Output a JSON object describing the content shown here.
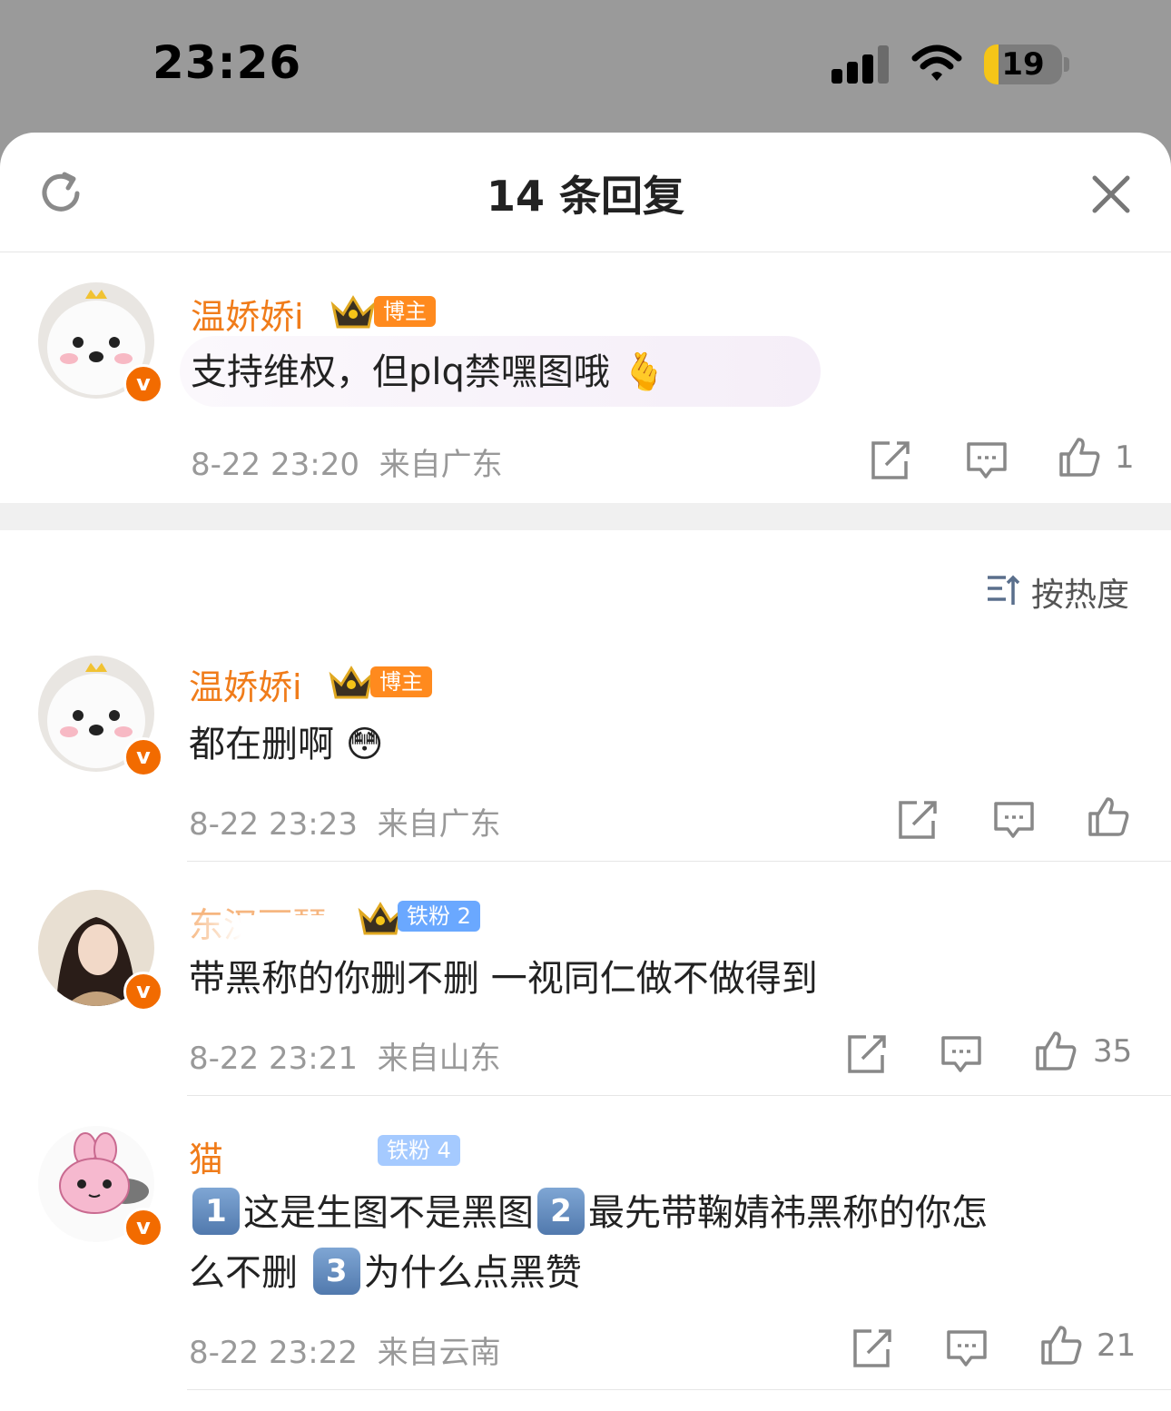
{
  "status_bar": {
    "time": "23:26",
    "battery": "19",
    "battery_level": 0.19
  },
  "header": {
    "title": "14 条回复"
  },
  "root_comment": {
    "username": "温娇娇i",
    "role_badge": "博主",
    "text": "支持维权，但plq禁嘿图哦",
    "emoji": "🫰",
    "date": "8-22 23:20",
    "location": "来自广东",
    "likes": "1"
  },
  "sort": {
    "label": "按热度"
  },
  "replies": [
    {
      "username": "温娇娇i",
      "role_badge": "博主",
      "text": "都在删啊",
      "emoji": "😳",
      "date": "8-22 23:23",
      "location": "来自广东",
      "likes": ""
    },
    {
      "username": "东汉丽琴",
      "fan_badge": "铁粉 2",
      "text": "带黑称的你删不删 一视同仁做不做得到",
      "date": "8-22 23:21",
      "location": "来自山东",
      "likes": "35"
    },
    {
      "username": "猫",
      "fan_badge": "铁粉 4",
      "parts": [
        "1",
        "这是生图不是黑图",
        "2",
        "最先带鞠婧祎黑称的你怎",
        "么不删",
        "3",
        "为什么点黑赞"
      ],
      "date": "8-22 23:22",
      "location": "来自云南",
      "likes": "21"
    }
  ],
  "icons": {
    "refresh": "refresh-icon",
    "close": "close-icon",
    "share": "share-icon",
    "comment": "comment-icon",
    "like": "thumbs-up-icon",
    "sort": "sort-icon",
    "verified": "verified-v-icon",
    "crown": "crown-icon"
  },
  "colors": {
    "username": "#f07c1a",
    "role_badge": "#ff8a1e",
    "fan_badge": "#6aa8ff",
    "verified": "#f26b00"
  }
}
